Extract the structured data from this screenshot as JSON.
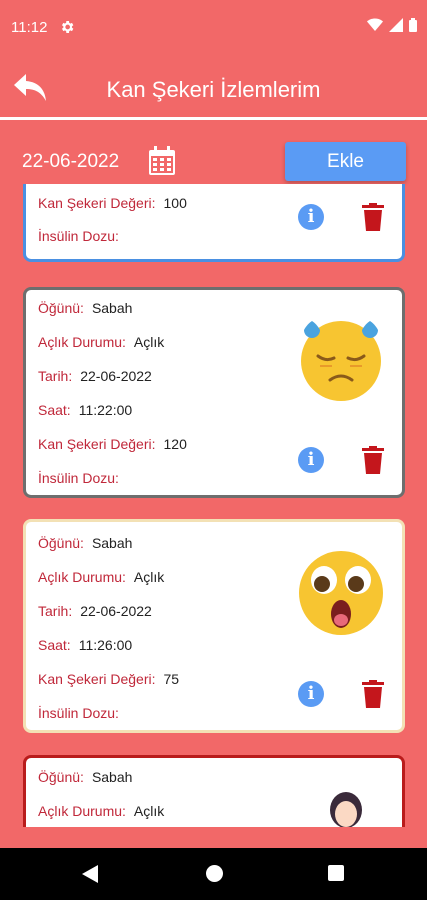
{
  "status": {
    "time": "11:12"
  },
  "header": {
    "title": "Kan Şekeri İzlemlerim"
  },
  "toolbar": {
    "date": "22-06-2022",
    "add_label": "Ekle"
  },
  "labels": {
    "meal": "Öğünü:",
    "fasting": "Açlık Durumu:",
    "date": "Tarih:",
    "time": "Saat:",
    "sugar": "Kan Şekeri Değeri:",
    "insulin": "İnsülin Dozu:"
  },
  "entries": [
    {
      "sugar": "100",
      "insulin": ""
    },
    {
      "meal": "Sabah",
      "fasting": "Açlık",
      "date": "22-06-2022",
      "time": "11:22:00",
      "sugar": "120",
      "insulin": "",
      "emoji": "sad-sweat-emoji"
    },
    {
      "meal": "Sabah",
      "fasting": "Açlık",
      "date": "22-06-2022",
      "time": "11:26:00",
      "sugar": "75",
      "insulin": "",
      "emoji": "shocked-emoji"
    },
    {
      "meal": "Sabah",
      "fasting": "Açlık",
      "emoji": "woman-icon"
    }
  ],
  "info_glyph": "i",
  "colors": {
    "background": "#f26868",
    "accent": "#5a9bf4",
    "label": "#c0283a",
    "trash": "#c4161c"
  }
}
